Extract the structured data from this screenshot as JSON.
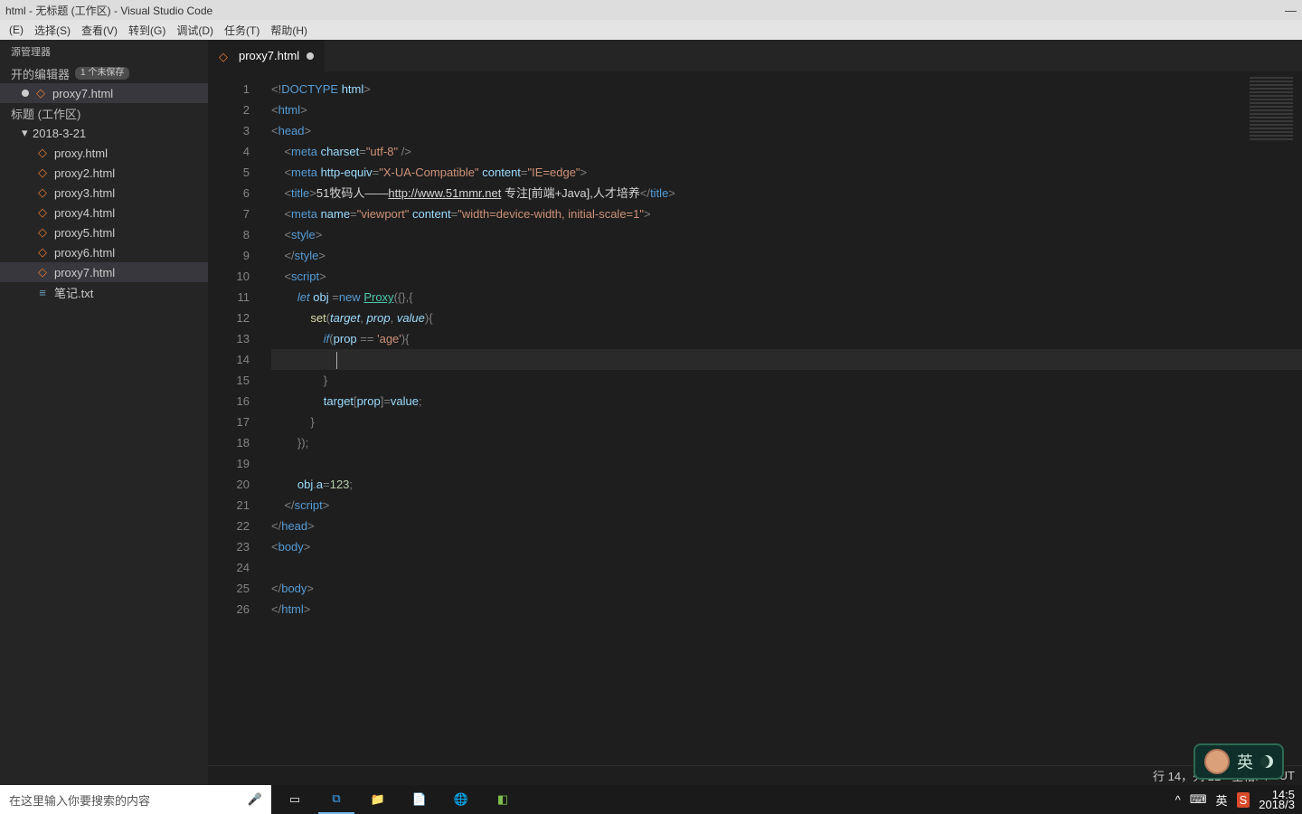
{
  "title": "html - 无标题 (工作区) - Visual Studio Code",
  "menus": [
    "(E)",
    "选择(S)",
    "查看(V)",
    "转到(G)",
    "调试(D)",
    "任务(T)",
    "帮助(H)"
  ],
  "sidebar": {
    "title": "源管理器",
    "open_editors_label": "开的编辑器",
    "unsaved_badge": "1 个未保存",
    "workspace_label": "标题 (工作区)",
    "folder": "2018-3-21",
    "files": [
      "proxy.html",
      "proxy2.html",
      "proxy3.html",
      "proxy4.html",
      "proxy5.html",
      "proxy6.html",
      "proxy7.html",
      "笔记.txt"
    ],
    "open_file": "proxy7.html",
    "selected_file": "proxy7.html"
  },
  "tab": {
    "label": "proxy7.html"
  },
  "code_lines": [
    "<!DOCTYPE html>",
    "<html>",
    "<head>",
    "    <meta charset=\"utf-8\" />",
    "    <meta http-equiv=\"X-UA-Compatible\" content=\"IE=edge\">",
    "    <title>51牧码人——http://www.51mmr.net 专注[前端+Java],人才培养</title>",
    "    <meta name=\"viewport\" content=\"width=device-width, initial-scale=1\">",
    "    <style>",
    "    </style>",
    "    <script>",
    "        let obj =new Proxy({},{",
    "            set(target, prop, value){",
    "                if(prop == 'age'){",
    "                    ",
    "                }",
    "                target[prop]=value;",
    "            }",
    "        });",
    "",
    "        obj.a=123;",
    "    </script>",
    "</head>",
    "<body>",
    "",
    "</body>",
    "</html>"
  ],
  "status": {
    "ln_col": "行 14，列 21",
    "spaces": "空格: 4",
    "encoding": "UT"
  },
  "taskbar": {
    "search_placeholder": "在这里输入你要搜索的内容",
    "time": "14:5",
    "date": "2018/3"
  },
  "ime": "英"
}
